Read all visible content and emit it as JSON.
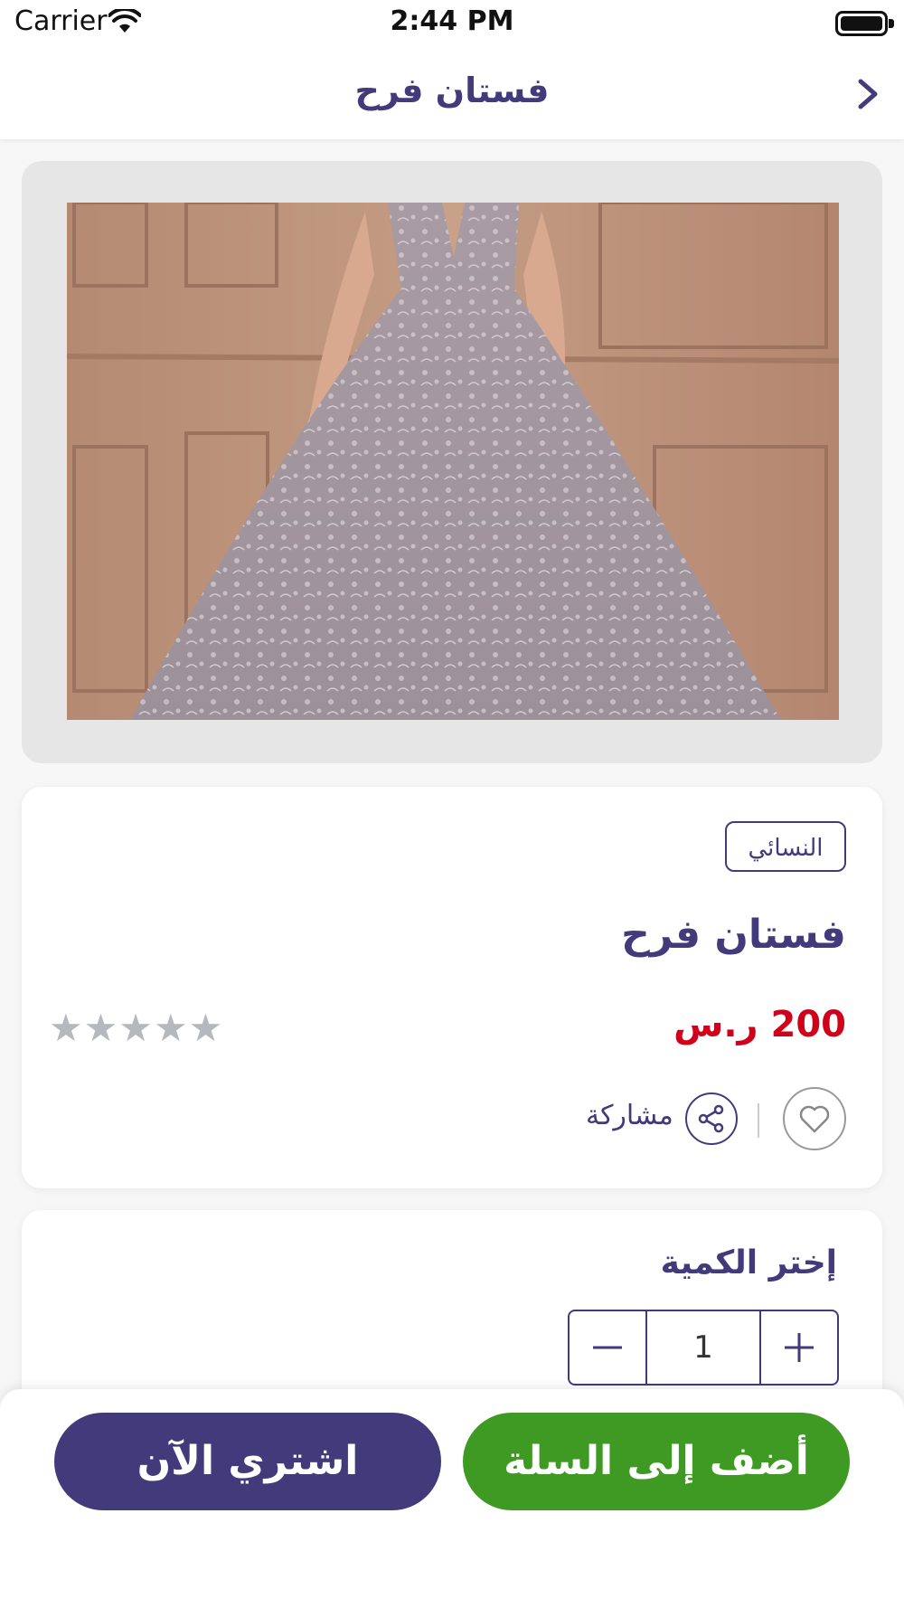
{
  "status_bar": {
    "carrier": "Carrier",
    "time": "2:44 PM"
  },
  "nav": {
    "title": "فستان فرح",
    "back_icon": "chevron-right-icon"
  },
  "product": {
    "category_tag": "النسائي",
    "name": "فستان فرح",
    "price": "200 ر.س",
    "rating": {
      "stars": "★★★★★",
      "filled": 0,
      "max": 5
    },
    "share_label": "مشاركة"
  },
  "quantity": {
    "title": "إختر الكمية",
    "value": "1"
  },
  "actions": {
    "buy_now": "اشتري الآن",
    "add_to_cart": "أضف إلى السلة"
  },
  "colors": {
    "primary": "#433a7b",
    "price": "#d0021b",
    "add_to_cart": "#3f9a23",
    "star_empty": "#b5b8bd"
  }
}
